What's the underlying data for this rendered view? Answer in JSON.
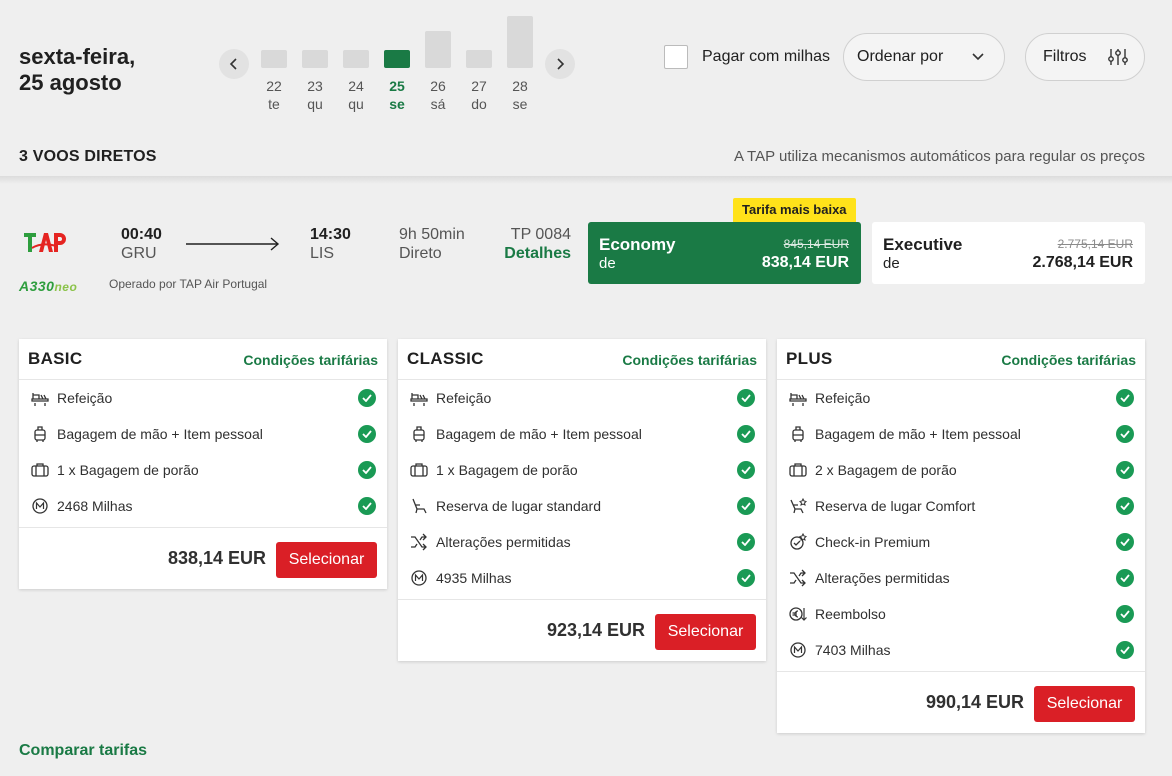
{
  "header": {
    "date_line1": "sexta-feira,",
    "date_line2": "25 agosto",
    "days": [
      {
        "num": "22",
        "wd": "te",
        "bar_level": 0.34
      },
      {
        "num": "23",
        "wd": "qu",
        "bar_level": 0.34
      },
      {
        "num": "24",
        "wd": "qu",
        "bar_level": 0.34
      },
      {
        "num": "25",
        "wd": "se",
        "bar_level": 0.34,
        "selected": true
      },
      {
        "num": "26",
        "wd": "sá",
        "bar_level": 0.71
      },
      {
        "num": "27",
        "wd": "do",
        "bar_level": 0.34
      },
      {
        "num": "28",
        "wd": "se",
        "bar_level": 1.0
      }
    ],
    "pay_with_miles": "Pagar com milhas",
    "sort_label": "Ordenar por",
    "filters_label": "Filtros",
    "flights_count": "3 VOOS DIRETOS",
    "price_note": "A TAP utiliza mecanismos automáticos para regular os preços"
  },
  "flight": {
    "airline_logo": "TAP",
    "aircraft": "A330",
    "aircraft_suffix": "neo",
    "operated_by": "Operado por TAP Air Portugal",
    "departure_time": "00:40",
    "departure_code": "GRU",
    "arrival_time": "14:30",
    "arrival_code": "LIS",
    "duration": "9h 50min",
    "stops": "Direto",
    "flight_number": "TP 0084",
    "details_label": "Detalhes",
    "badge": "Tarifa mais baixa",
    "economy": {
      "name": "Economy",
      "from": "de",
      "old_price": "845,14 EUR",
      "price": "838,14 EUR"
    },
    "executive": {
      "name": "Executive",
      "from": "de",
      "old_price": "2.775,14 EUR",
      "price": "2.768,14 EUR"
    }
  },
  "fares": [
    {
      "title": "BASIC",
      "conditions": "Condições tarifárias",
      "features": [
        {
          "icon": "meal-icon",
          "text": "Refeição"
        },
        {
          "icon": "cabin-bag-icon",
          "text": "Bagagem de mão + Item pessoal"
        },
        {
          "icon": "suitcase-icon",
          "text": "1 x Bagagem de porão"
        },
        {
          "icon": "miles-icon",
          "text": "2468 Milhas"
        }
      ],
      "price": "838,14 EUR",
      "select": "Selecionar"
    },
    {
      "title": "CLASSIC",
      "conditions": "Condições tarifárias",
      "features": [
        {
          "icon": "meal-icon",
          "text": "Refeição"
        },
        {
          "icon": "cabin-bag-icon",
          "text": "Bagagem de mão + Item pessoal"
        },
        {
          "icon": "suitcase-icon",
          "text": "1 x Bagagem de porão"
        },
        {
          "icon": "seat-icon",
          "text": "Reserva de lugar standard"
        },
        {
          "icon": "shuffle-icon",
          "text": "Alterações permitidas"
        },
        {
          "icon": "miles-icon",
          "text": "4935 Milhas"
        }
      ],
      "price": "923,14 EUR",
      "select": "Selecionar"
    },
    {
      "title": "PLUS",
      "conditions": "Condições tarifárias",
      "features": [
        {
          "icon": "meal-icon",
          "text": "Refeição"
        },
        {
          "icon": "cabin-bag-icon",
          "text": "Bagagem de mão + Item pessoal"
        },
        {
          "icon": "suitcase-icon",
          "text": "2 x Bagagem de porão"
        },
        {
          "icon": "comfort-seat-icon",
          "text": "Reserva de lugar Comfort"
        },
        {
          "icon": "checkin-icon",
          "text": "Check-in Premium"
        },
        {
          "icon": "shuffle-icon",
          "text": "Alterações permitidas"
        },
        {
          "icon": "refund-icon",
          "text": "Reembolso"
        },
        {
          "icon": "miles-icon",
          "text": "7403 Milhas"
        }
      ],
      "price": "990,14 EUR",
      "select": "Selecionar"
    }
  ],
  "compare_label": "Comparar tarifas",
  "colors": {
    "brand_green": "#1a7a45",
    "select_red": "#da1f26",
    "badge_yellow": "#ffe21a"
  }
}
